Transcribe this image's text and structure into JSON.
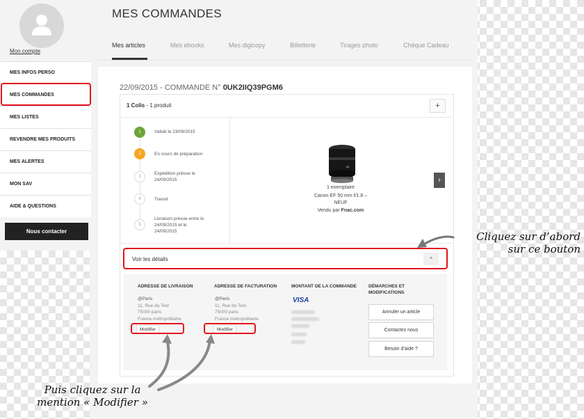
{
  "sidebar": {
    "account_label": "Mon compte",
    "items": [
      {
        "label": "MES INFOS PERSO"
      },
      {
        "label": "MES COMMANDES"
      },
      {
        "label": "MES LISTES"
      },
      {
        "label": "REVENDRE MES PRODUITS"
      },
      {
        "label": "MES ALERTES"
      },
      {
        "label": "MON SAV"
      },
      {
        "label": "AIDE & QUESTIONS"
      }
    ],
    "contact_label": "Nous contacter"
  },
  "page": {
    "title": "MES COMMANDES",
    "tabs": [
      {
        "label": "Mes articles"
      },
      {
        "label": "Mes ebooks"
      },
      {
        "label": "Mes digicopy"
      },
      {
        "label": "Billetterie"
      },
      {
        "label": "Tirages photo"
      },
      {
        "label": "Chèque Cadeau"
      }
    ]
  },
  "order": {
    "date": "22/09/2015",
    "prefix": " - COMMANDE N°",
    "number": "0UK2IIQ39PGM6",
    "colis_count": "1 Colis",
    "colis_products": " - 1 produit",
    "expand_label": "+",
    "steps": [
      {
        "num": "1",
        "label": "Validé le 23/09/2015",
        "state": "done"
      },
      {
        "num": "2",
        "label": "En cours de préparation",
        "state": "current"
      },
      {
        "num": "3",
        "label": "Expédition prévue le 24/09/2015",
        "state": "todo"
      },
      {
        "num": "4",
        "label": "Transit",
        "state": "todo"
      },
      {
        "num": "5",
        "label": "Livraison prévue entre le 24/09/2015 et le 24/09/2015",
        "state": "todo"
      }
    ],
    "product": {
      "quantity": "1 exemplaire",
      "name": "Canon EF 50 mm f/1.8 –",
      "condition": "NEUF",
      "sold_by_prefix": "Vendu par ",
      "sold_by": "Fnac.com"
    },
    "next_label": "›",
    "details_label": "Voir les détails",
    "collapse_label": "^"
  },
  "details": {
    "delivery": {
      "heading": "ADRESSE DE LIVRAISON",
      "name": "@Paris",
      "line1": "11, Rue du Test",
      "line2": "75000 paris",
      "line3": "France métropolitaine",
      "edit": "Modifier"
    },
    "billing": {
      "heading": "ADRESSE DE FACTURATION",
      "name": "@Paris",
      "line1": "11, Rue du Test",
      "line2": "75000 paris",
      "line3": "France métropolitaine",
      "edit": "Modifier"
    },
    "amount": {
      "heading": "MONTANT DE LA COMMANDE",
      "card_brand": "VISA"
    },
    "actions": {
      "heading_line1": "DÉMARCHES ET",
      "heading_line2": "MODIFICATIONS",
      "buttons": [
        {
          "label": "Annuler un article"
        },
        {
          "label": "Contactez nous"
        },
        {
          "label": "Besoin d'aide ?"
        }
      ]
    }
  },
  "annotations": {
    "right_line1": "Cliquez sur d’abord",
    "right_line2": "sur ce bouton",
    "left_line1": "Puis cliquez sur la",
    "left_line2": "mention « Modifier »"
  },
  "colors": {
    "highlight": "#e3141c",
    "step_done": "#6ea43b",
    "step_current": "#f5a623",
    "visa": "#1a3fa0"
  }
}
